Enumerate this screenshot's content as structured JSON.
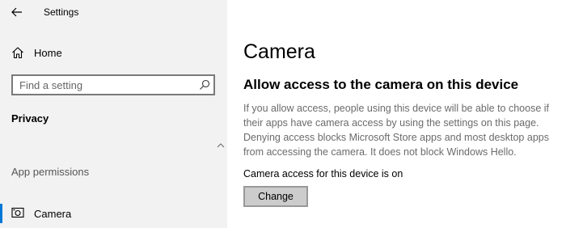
{
  "window": {
    "title": "Settings"
  },
  "sidebar": {
    "home_label": "Home",
    "search_placeholder": "Find a setting",
    "section_title": "Privacy",
    "group_label": "App permissions",
    "items": [
      {
        "label": "Camera",
        "icon": "camera-icon",
        "selected": true
      }
    ]
  },
  "main": {
    "title": "Camera",
    "heading": "Allow access to the camera on this device",
    "description": "If you allow access, people using this device will be able to choose if their apps have camera access by using the settings on this page. Denying access blocks Microsoft Store apps and most desktop apps from accessing the camera. It does not block Windows Hello.",
    "status": "Camera access for this device is on",
    "change_label": "Change"
  },
  "colors": {
    "accent": "#0078d7",
    "sidebar_bg": "#f2f2f2",
    "description_text": "#6b6b6b"
  }
}
